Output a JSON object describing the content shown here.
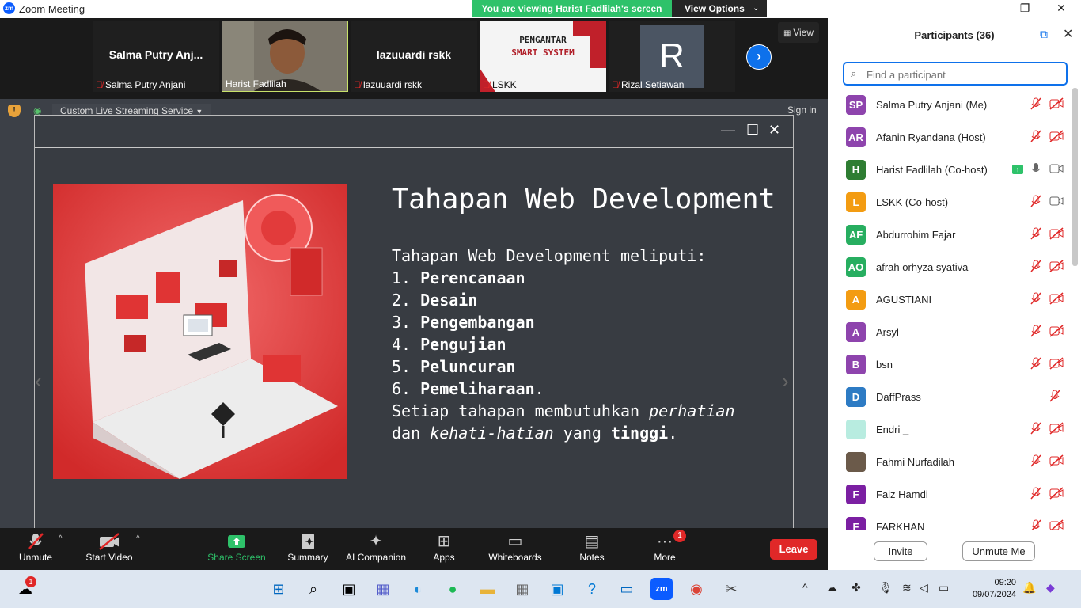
{
  "window": {
    "app_title": "Zoom Meeting",
    "logo_text": "zm",
    "minimize": "—",
    "restore": "❐",
    "close": "✕"
  },
  "banner": {
    "viewing_text": "You are viewing Harist Fadlilah's screen",
    "view_options": "View Options"
  },
  "thumbnails": [
    {
      "big_name": "Salma Putry Anj...",
      "label": "Salma Putry Anjani",
      "muted": true
    },
    {
      "big_name": "",
      "label": "Harist Fadlilah",
      "muted": false
    },
    {
      "big_name": "lazuuardi rskk",
      "label": "lazuuardi rskk",
      "muted": true
    },
    {
      "big_name": "",
      "label": "LSKK",
      "muted": true,
      "slide_line1": "PENGANTAR",
      "slide_line2": "SMART SYSTEM"
    },
    {
      "big_name": "R",
      "label": "Rizal Setiawan",
      "muted": true
    }
  ],
  "view_button": "View",
  "share_toolbar": {
    "stream_service": "Custom Live Streaming Service",
    "sign_in": "Sign in"
  },
  "slide": {
    "title": "Tahapan Web Development",
    "intro": "Tahapan Web Development meliputi:",
    "steps": [
      "Perencanaan",
      "Desain",
      "Pengembangan",
      "Pengujian",
      "Peluncuran",
      "Pemeliharaan"
    ],
    "closing_1": "Setiap tahapan membutuhkan ",
    "closing_em1": "perhatian",
    "closing_2": "dan ",
    "closing_em2": "kehati-hatian",
    "closing_3": " yang ",
    "closing_strong": "tinggi",
    "closing_end": "."
  },
  "toolbar": {
    "unmute": "Unmute",
    "start_video": "Start Video",
    "share_screen": "Share Screen",
    "summary": "Summary",
    "ai_companion": "AI Companion",
    "apps": "Apps",
    "whiteboards": "Whiteboards",
    "notes": "Notes",
    "more": "More",
    "more_badge": "1",
    "leave": "Leave"
  },
  "participants": {
    "title": "Participants (36)",
    "search_placeholder": "Find a participant",
    "list": [
      {
        "initials": "SP",
        "name": "Salma Putry Anjani (Me)",
        "color": "#8e44ad",
        "mic": "muted",
        "video": "off"
      },
      {
        "initials": "AR",
        "name": "Afanin Ryandana (Host)",
        "color": "#8e44ad",
        "mic": "muted",
        "video": "off"
      },
      {
        "initials": "H",
        "name": "Harist Fadlilah (Co-host)",
        "color": "#2e7d32",
        "mic": "on",
        "video": "on",
        "sharing": true
      },
      {
        "initials": "L",
        "name": "LSKK (Co-host)",
        "color": "#f39c12",
        "mic": "muted",
        "video": "on"
      },
      {
        "initials": "AF",
        "name": "Abdurrohim Fajar",
        "color": "#27ae60",
        "mic": "muted",
        "video": "off"
      },
      {
        "initials": "AO",
        "name": "afrah orhyza syativa",
        "color": "#27ae60",
        "mic": "muted",
        "video": "off"
      },
      {
        "initials": "A",
        "name": "AGUSTIANI",
        "color": "#f39c12",
        "mic": "muted",
        "video": "off"
      },
      {
        "initials": "A",
        "name": "Arsyl",
        "color": "#8e44ad",
        "mic": "muted",
        "video": "off"
      },
      {
        "initials": "B",
        "name": "bsn",
        "color": "#8e44ad",
        "mic": "muted",
        "video": "off"
      },
      {
        "initials": "D",
        "name": "DaffPrass",
        "color": "#2d7bc4",
        "mic": "muted",
        "video": "none"
      },
      {
        "initials": "",
        "name": "Endri _",
        "color": "#b8ece0",
        "mic": "muted",
        "video": "off"
      },
      {
        "initials": "",
        "name": "Fahmi Nurfadilah",
        "color": "#6b5a4a",
        "mic": "muted",
        "video": "off"
      },
      {
        "initials": "F",
        "name": "Faiz Hamdi",
        "color": "#7b1fa2",
        "mic": "muted",
        "video": "off"
      },
      {
        "initials": "F",
        "name": "FARKHAN",
        "color": "#7b1fa2",
        "mic": "muted",
        "video": "off"
      }
    ],
    "invite": "Invite",
    "unmute_me": "Unmute Me"
  },
  "taskbar": {
    "time": "09:20",
    "date": "09/07/2024",
    "weather_badge": "1"
  }
}
